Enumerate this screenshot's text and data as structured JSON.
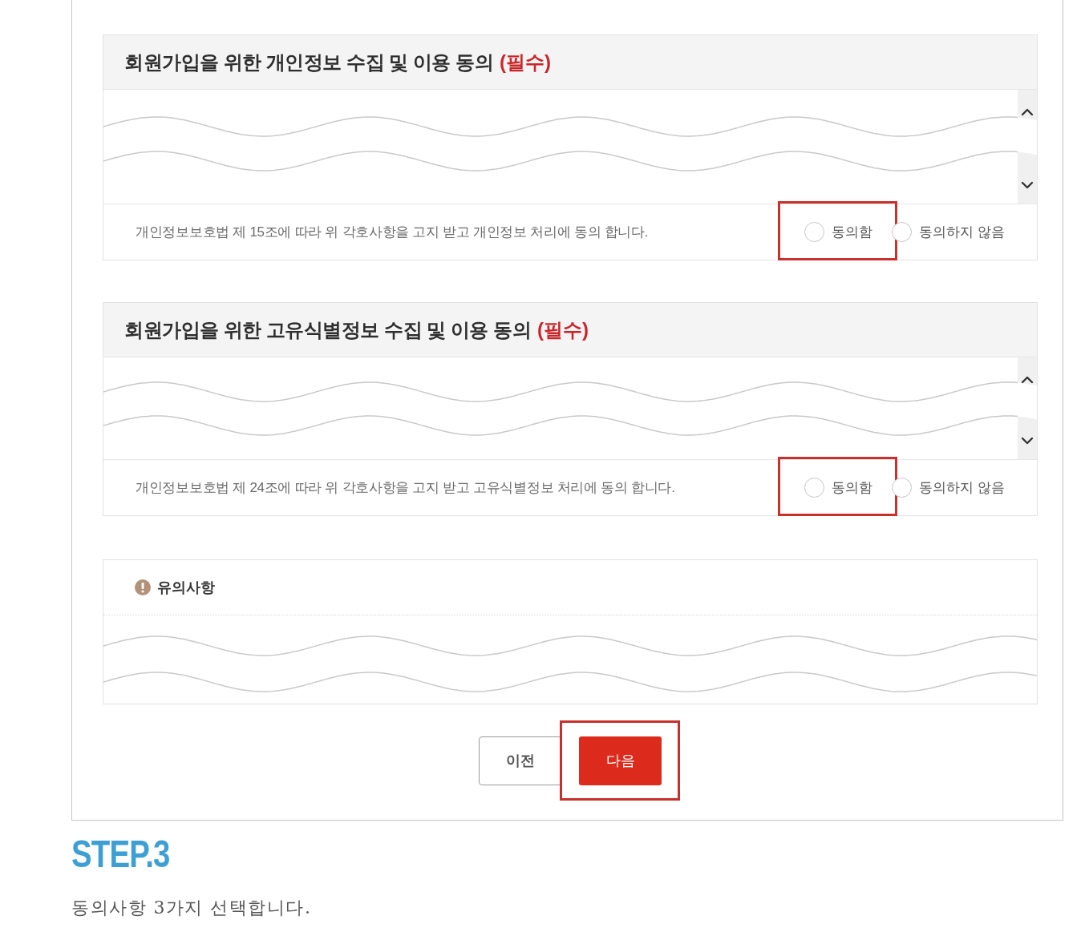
{
  "sections": [
    {
      "title": "회원가입을 위한 개인정보 수집 및 이용 동의",
      "required_label": "(필수)",
      "consent_text": "개인정보보호법 제 15조에 따라 위 각호사항을 고지 받고 개인정보 처리에 동의 합니다.",
      "options": [
        {
          "label": "동의함",
          "selected": false,
          "highlighted": true
        },
        {
          "label": "동의하지 않음",
          "selected": false,
          "highlighted": false
        }
      ]
    },
    {
      "title": "회원가입을 위한 고유식별정보 수집 및 이용 동의",
      "required_label": "(필수)",
      "consent_text": "개인정보보호법 제 24조에 따라 위 각호사항을 고지 받고 고유식별정보 처리에 동의 합니다.",
      "options": [
        {
          "label": "동의함",
          "selected": false,
          "highlighted": true
        },
        {
          "label": "동의하지 않음",
          "selected": false,
          "highlighted": false
        }
      ]
    }
  ],
  "notice": {
    "title": "유의사항"
  },
  "buttons": [
    {
      "label": "이전",
      "kind": "secondary",
      "highlighted": false
    },
    {
      "label": "다음",
      "kind": "primary",
      "highlighted": true
    }
  ],
  "step": {
    "heading": "STEP.3",
    "description": "동의사항 3가지 선택합니다."
  }
}
